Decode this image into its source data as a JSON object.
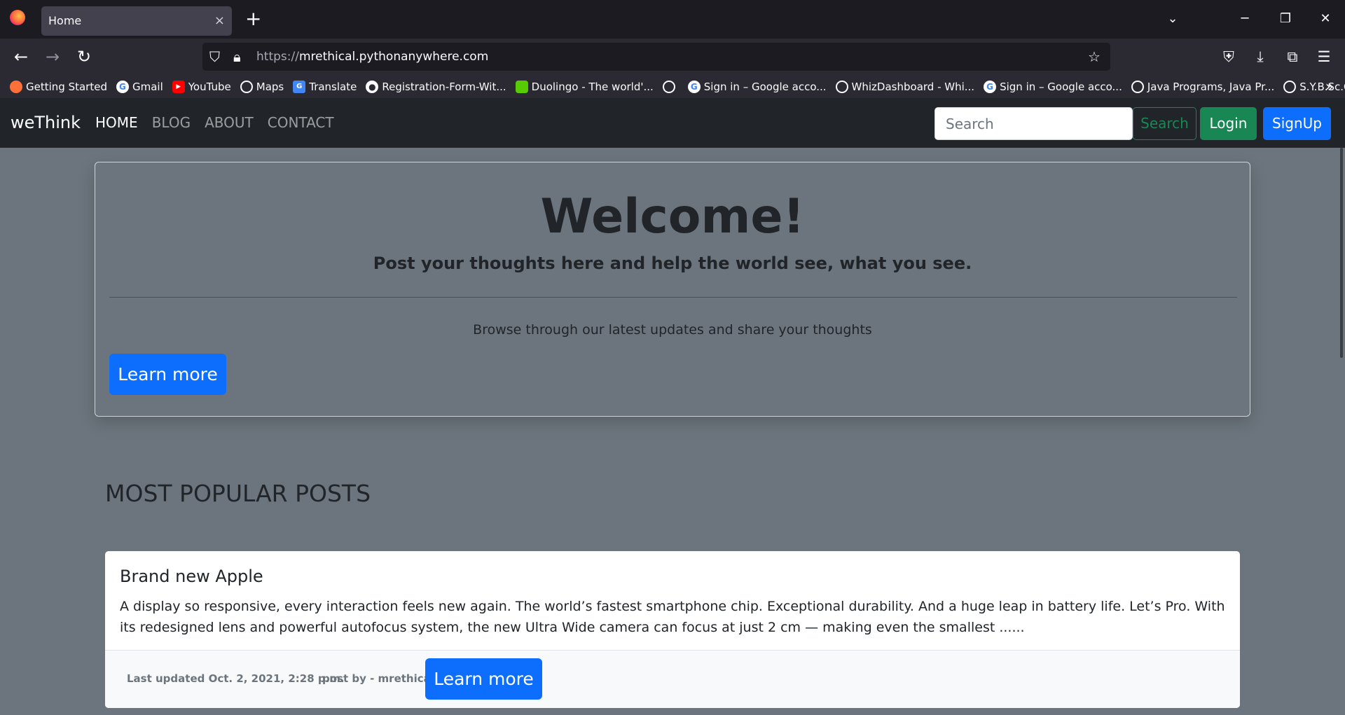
{
  "browser": {
    "tab_title": "Home",
    "tab_close": "×",
    "new_tab": "+",
    "url_protocol": "https://",
    "url_host": "mrethical.pythonanywhere.com",
    "bookmarks": [
      {
        "label": "Getting Started",
        "icon": "firefox-icon"
      },
      {
        "label": "Gmail",
        "icon": "google-icon"
      },
      {
        "label": "YouTube",
        "icon": "youtube-icon"
      },
      {
        "label": "Maps",
        "icon": "globe-icon"
      },
      {
        "label": "Translate",
        "icon": "translate-icon"
      },
      {
        "label": "Registration-Form-Wit...",
        "icon": "github-icon"
      },
      {
        "label": "Duolingo - The world'...",
        "icon": "duolingo-icon"
      },
      {
        "label": "",
        "icon": "globe-icon"
      },
      {
        "label": "Sign in – Google acco...",
        "icon": "google-icon"
      },
      {
        "label": "WhizDashboard - Whi...",
        "icon": "globe-icon"
      },
      {
        "label": "Sign in – Google acco...",
        "icon": "google-icon"
      },
      {
        "label": "Java Programs, Java Pr...",
        "icon": "globe-icon"
      },
      {
        "label": "S.Y.B.Sc.C.S.",
        "icon": "globe-icon"
      }
    ]
  },
  "site": {
    "brand": "weThink",
    "menu": [
      {
        "label": "HOME",
        "active": true
      },
      {
        "label": "BLOG",
        "active": false
      },
      {
        "label": "ABOUT",
        "active": false
      },
      {
        "label": "CONTACT",
        "active": false
      }
    ],
    "search_placeholder": "Search",
    "search_button": "Search",
    "login_button": "Login",
    "signup_button": "SignUp"
  },
  "jumbotron": {
    "heading": "Welcome!",
    "lead": "Post your thoughts here and help the world see, what you see.",
    "text": "Browse through our latest updates and share your thoughts",
    "button": "Learn more"
  },
  "popular": {
    "title": "MOST POPULAR POSTS",
    "posts": [
      {
        "title": "Brand new Apple",
        "excerpt": "A display so responsive, every interaction feels new again. The world’s fastest smartphone chip. Exceptional durability. And a huge leap in battery life. Let’s Pro. With its redesigned lens and powerful autofocus system, the new Ultra Wide camera can focus at just 2 cm — making even the smallest ......",
        "updated": "Last updated Oct. 2, 2021, 2:28 p.m.",
        "author": "post by - mrethical",
        "button": "Learn more"
      }
    ]
  },
  "colors": {
    "page_bg": "#6c757d",
    "nav_bg": "#212529",
    "primary": "#0d6efd",
    "success": "#198754"
  }
}
